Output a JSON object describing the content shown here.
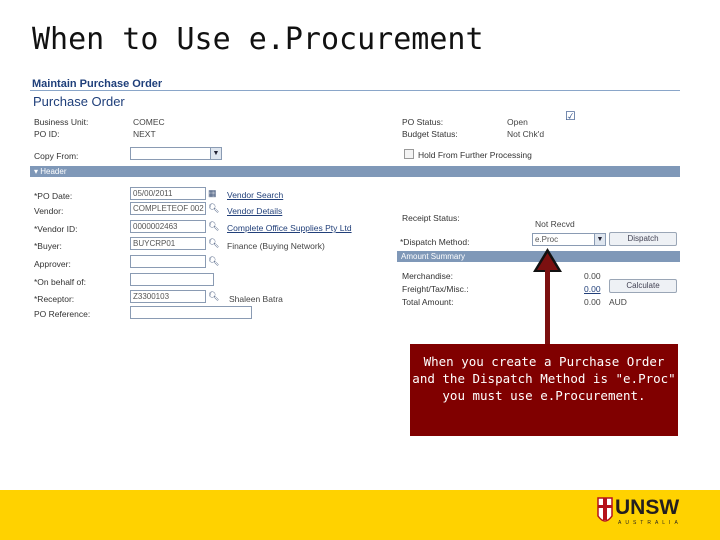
{
  "slide": {
    "title": "When to Use e.Procurement"
  },
  "page": {
    "breadcrumb": "Maintain Purchase Order",
    "title": "Purchase Order"
  },
  "fields": {
    "business_unit_label": "Business Unit:",
    "business_unit_value": "COMEC",
    "po_id_label": "PO ID:",
    "po_id_value": "NEXT",
    "copy_from_label": "Copy From:",
    "po_status_label": "PO Status:",
    "po_status_value": "Open",
    "budget_status_label": "Budget Status:",
    "budget_status_value": "Not Chk'd",
    "hold_label": "Hold From Further Processing"
  },
  "header_section": {
    "label": "Header",
    "po_date_label": "*PO Date:",
    "po_date_value": "05/00/2011",
    "vendor_search": "Vendor Search",
    "vendor_label": "Vendor:",
    "vendor_value": "COMPLETEOF 002",
    "vendor_details": "Vendor Details",
    "vendor_id_label": "*Vendor ID:",
    "vendor_id_value": "0000002463",
    "vendor_name": "Complete Office Supplies Pty Ltd",
    "buyer_label": "*Buyer:",
    "buyer_value": "BUYCRP01",
    "buyer_name": "Finance (Buying Network)",
    "approver_label": "Approver:",
    "on_behalf_label": "*On behalf of:",
    "receptor_label": "*Receptor:",
    "receptor_value": "Z3300103",
    "receptor_name": "Shaleen Batra",
    "po_reference_label": "PO Reference:",
    "receipt_status_label": "Receipt Status:",
    "receipt_status_value": "Not Recvd",
    "dispatch_method_label": "*Dispatch Method:",
    "dispatch_method_value": "e.Proc",
    "dispatch_button": "Dispatch"
  },
  "amount_summary": {
    "label": "Amount Summary",
    "merchandise_label": "Merchandise:",
    "merchandise_value": "0.00",
    "freight_label": "Freight/Tax/Misc.:",
    "freight_value": "0.00",
    "total_label": "Total Amount:",
    "total_value": "0.00",
    "currency": "AUD",
    "calculate_button": "Calculate"
  },
  "callout": {
    "text": "When you create a Purchase Order and the Dispatch Method is \"e.Proc\" you must use e.Procurement."
  },
  "footer": {
    "logo_text": "UNSW",
    "logo_sub": "AUSTRALIA"
  },
  "colors": {
    "callout_bg": "#800000",
    "footer_bg": "#ffd200",
    "section_band": "#7f98b8",
    "title_blue": "#1f3f7a"
  }
}
